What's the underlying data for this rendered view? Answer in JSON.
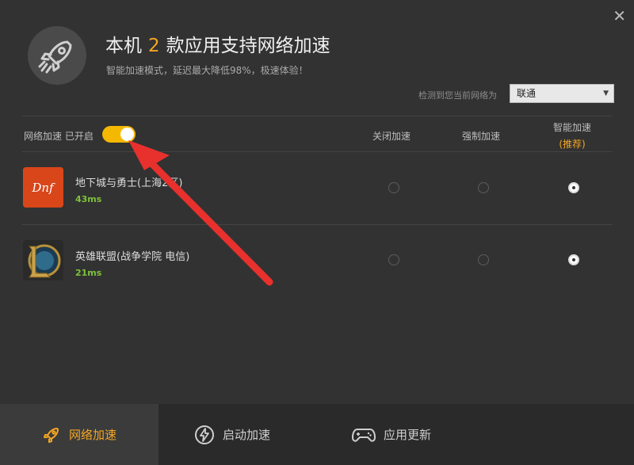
{
  "header": {
    "title_prefix": "本机",
    "count": "2",
    "title_suffix": "款应用支持网络加速",
    "subtitle": "智能加速模式，延迟最大降低98%，极速体验！"
  },
  "network": {
    "label": "检测到您当前网络为",
    "selected": "联通"
  },
  "accel": {
    "label": "网络加速 已开启",
    "enabled": true
  },
  "columns": {
    "off": "关闭加速",
    "force": "强制加速",
    "smart": "智能加速",
    "recommended": "(推荐)"
  },
  "games": [
    {
      "name": "地下城与勇士(上海2区)",
      "ping": "43ms",
      "mode": "smart",
      "icon": "dnf-icon"
    },
    {
      "name": "英雄联盟(战争学院 电信)",
      "ping": "21ms",
      "mode": "smart",
      "icon": "lol-icon"
    }
  ],
  "tabs": [
    {
      "label": "网络加速",
      "icon": "rocket-icon",
      "active": true
    },
    {
      "label": "启动加速",
      "icon": "lightning-icon",
      "active": false
    },
    {
      "label": "应用更新",
      "icon": "gamepad-icon",
      "active": false
    }
  ],
  "colors": {
    "accent": "#f5a623",
    "toggle": "#f5b800",
    "ping": "#7ec23b",
    "annotation_arrow": "#e8302c"
  }
}
